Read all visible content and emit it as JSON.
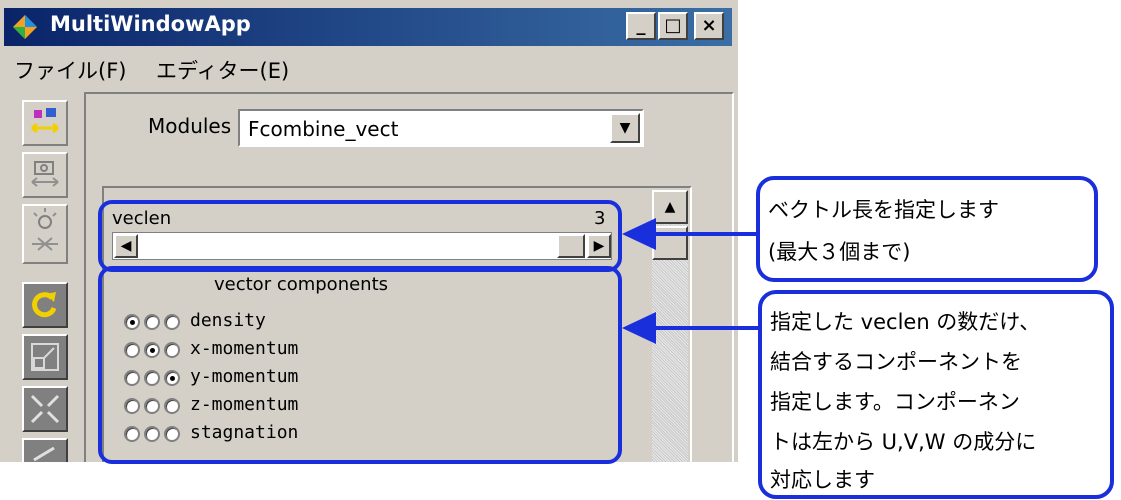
{
  "window": {
    "title": "MultiWindowApp",
    "minimize": "_",
    "maximize": "□",
    "close": "×"
  },
  "menu": {
    "items": [
      "ファイル(F)",
      "エディター(E)"
    ]
  },
  "toolbar": {
    "buttons": [
      "network-icon",
      "camera-icon",
      "light-icon",
      "rotate-icon",
      "fit-icon",
      "zoom-icon",
      "pan-icon"
    ]
  },
  "modules": {
    "label": "Modules",
    "selected": "Fcombine_vect"
  },
  "veclen": {
    "label": "veclen",
    "value": "3"
  },
  "vector_components": {
    "title": "vector components",
    "rows": [
      {
        "name": "density",
        "selected": 0
      },
      {
        "name": "x-momentum",
        "selected": 1
      },
      {
        "name": "y-momentum",
        "selected": 2
      },
      {
        "name": "z-momentum",
        "selected": -1
      },
      {
        "name": "stagnation",
        "selected": -1
      }
    ]
  },
  "callouts": {
    "veclen": {
      "line1": "ベクトル長を指定します",
      "line2": "(最大３個まで)"
    },
    "components": {
      "line1": "指定した veclen の数だけ、",
      "line2": "結合するコンポーネントを",
      "line3": "指定します。コンポーネン",
      "line4": "トは左から U,V,W の成分に",
      "line5": "対応します"
    }
  },
  "colors": {
    "annotation": "#1a2fdc",
    "titlebar": "#0a246a",
    "face": "#d4d0c8"
  }
}
